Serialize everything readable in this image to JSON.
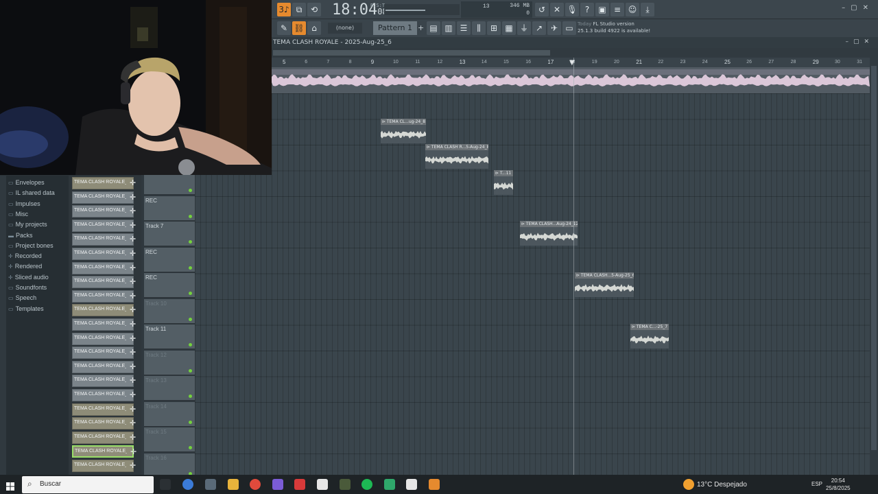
{
  "toolbar": {
    "time": "18:04",
    "time_sub": "08",
    "time_small": "B:S:T",
    "memory_mb": "346 MB",
    "cpu_top": "13",
    "cpu_bottom": "0",
    "pattern_none": "(none)",
    "pattern": "Pattern 1",
    "pattern_plus": "+",
    "notif_today": "Today",
    "notif_title": "FL Studio version",
    "notif_body": "25.1.3 build 4922 is available!"
  },
  "playlist": {
    "title": "TEMA CLASH ROYALE - 2025-Aug-25_6",
    "ruler_numbers": [
      "5",
      "6",
      "7",
      "8",
      "9",
      "10",
      "11",
      "12",
      "13",
      "14",
      "15",
      "16",
      "17",
      "18",
      "19",
      "20",
      "21",
      "22",
      "23",
      "24",
      "25",
      "26",
      "27",
      "28",
      "29",
      "30",
      "31"
    ],
    "clips": [
      {
        "label": "TEMA CL...ug-24_8"
      },
      {
        "label": "TEMA CLASH R...5-Aug-24_8"
      },
      {
        "label": "T...11"
      },
      {
        "label": "TEMA CLASH...Aug-24_12"
      },
      {
        "label": "TEMA CLASH...5-Aug-25_6"
      },
      {
        "label": "TEMA C...-25_7"
      }
    ]
  },
  "tracks": [
    {
      "label": "",
      "active": true
    },
    {
      "label": "REC",
      "active": true
    },
    {
      "label": "Track 7",
      "active": true
    },
    {
      "label": "REC",
      "active": true
    },
    {
      "label": "REC",
      "active": true
    },
    {
      "label": "Track 10",
      "active": false
    },
    {
      "label": "Track 11",
      "active": true
    },
    {
      "label": "Track 12",
      "active": false
    },
    {
      "label": "Track 13",
      "active": false
    },
    {
      "label": "Track 14",
      "active": false
    },
    {
      "label": "Track 15",
      "active": false
    },
    {
      "label": "Track 16",
      "active": false
    }
  ],
  "channels": [
    {
      "name": "TEMA CLASH ROYALE_",
      "tan": true,
      "sel": false
    },
    {
      "name": "TEMA CLASH ROYALE_202",
      "tan": false,
      "sel": false
    },
    {
      "name": "TEMA CLASH ROYALE_",
      "tan": false,
      "sel": false
    },
    {
      "name": "TEMA CLASH ROYALE_",
      "tan": false,
      "sel": false
    },
    {
      "name": "TEMA CLASH ROYALE_202",
      "tan": false,
      "sel": false
    },
    {
      "name": "TEMA CLASH ROYALE_",
      "tan": false,
      "sel": false
    },
    {
      "name": "TEMA CLASH ROYALE_202",
      "tan": false,
      "sel": false
    },
    {
      "name": "TEMA CLASH ROYALE_202",
      "tan": false,
      "sel": false
    },
    {
      "name": "TEMA CLASH ROYALE_202",
      "tan": false,
      "sel": false
    },
    {
      "name": "TEMA CLASH ROYALE_",
      "tan": true,
      "sel": false
    },
    {
      "name": "TEMA CLASH ROYALE_202",
      "tan": false,
      "sel": false
    },
    {
      "name": "TEMA CLASH ROYALE_202",
      "tan": false,
      "sel": false
    },
    {
      "name": "TEMA CLASH ROYALE_202",
      "tan": false,
      "sel": false
    },
    {
      "name": "TEMA CLASH ROYALE_202",
      "tan": false,
      "sel": false
    },
    {
      "name": "TEMA CLASH ROYALE_202",
      "tan": false,
      "sel": false
    },
    {
      "name": "TEMA CLASH ROYALE_202",
      "tan": false,
      "sel": false
    },
    {
      "name": "TEMA CLASH ROYALE_",
      "tan": true,
      "sel": false
    },
    {
      "name": "TEMA CLASH ROYALE_",
      "tan": true,
      "sel": false
    },
    {
      "name": "TEMA CLASH ROYALE_",
      "tan": true,
      "sel": false
    },
    {
      "name": "TEMA CLASH ROYALE_",
      "tan": true,
      "sel": true
    },
    {
      "name": "TEMA CLASH ROYALE_",
      "tan": true,
      "sel": false
    }
  ],
  "browser": {
    "items": [
      {
        "label": "Envelopes",
        "icon": "folder-icon"
      },
      {
        "label": "IL shared data",
        "icon": "folder-icon"
      },
      {
        "label": "Impulses",
        "icon": "folder-icon"
      },
      {
        "label": "Misc",
        "icon": "folder-icon"
      },
      {
        "label": "My projects",
        "icon": "folder-icon"
      },
      {
        "label": "Packs",
        "icon": "folder-filled-icon"
      },
      {
        "label": "Project bones",
        "icon": "folder-icon"
      },
      {
        "label": "Recorded",
        "icon": "plus-icon"
      },
      {
        "label": "Rendered",
        "icon": "plus-icon"
      },
      {
        "label": "Sliced audio",
        "icon": "plus-icon"
      },
      {
        "label": "Soundfonts",
        "icon": "folder-icon"
      },
      {
        "label": "Speech",
        "icon": "folder-icon"
      },
      {
        "label": "Templates",
        "icon": "folder-icon"
      }
    ]
  },
  "taskbar": {
    "search_placeholder": "Buscar",
    "weather": "13°C  Despejado",
    "lang": "ESP",
    "time": "20:54",
    "date": "25/8/2025"
  },
  "colors": {
    "accent": "#e68a2e",
    "active_dot": "#74d13e",
    "selected_border": "#9adf68"
  }
}
